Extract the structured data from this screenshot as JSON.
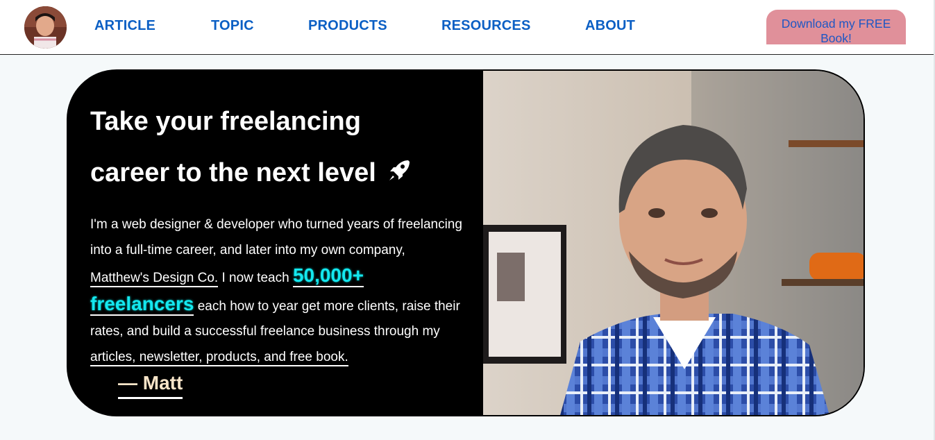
{
  "nav": {
    "items": [
      "ARTICLE",
      "TOPIC",
      "PRODUCTS",
      "RESOURCES",
      "ABOUT"
    ],
    "cta_label": "Download my FREE Book!"
  },
  "hero": {
    "title_line1": "Take your freelancing",
    "title_line2": "career to the next level",
    "bio_part1": "I'm a web designer & developer who turned years of freelancing into a full-time career, and later into my own company,",
    "company_link": "Matthew's Design Co.",
    "bio_part2": "I now teach",
    "count_link": "50,000+",
    "freelancers_link": "freelancers",
    "bio_part3": "each how to year get more clients, raise their rates, and build a successful freelance business through my",
    "resources_link": "articles, newsletter, products, and free book.",
    "signature": "— Matt"
  },
  "colors": {
    "nav_link": "#0b5fc4",
    "cta_bg": "#e0909a",
    "cta_text": "#1f57c3",
    "highlight": "#14e8ef",
    "hero_bg": "#000000",
    "signature": "#f7e4c8"
  },
  "icons": [
    "rocket-icon"
  ]
}
